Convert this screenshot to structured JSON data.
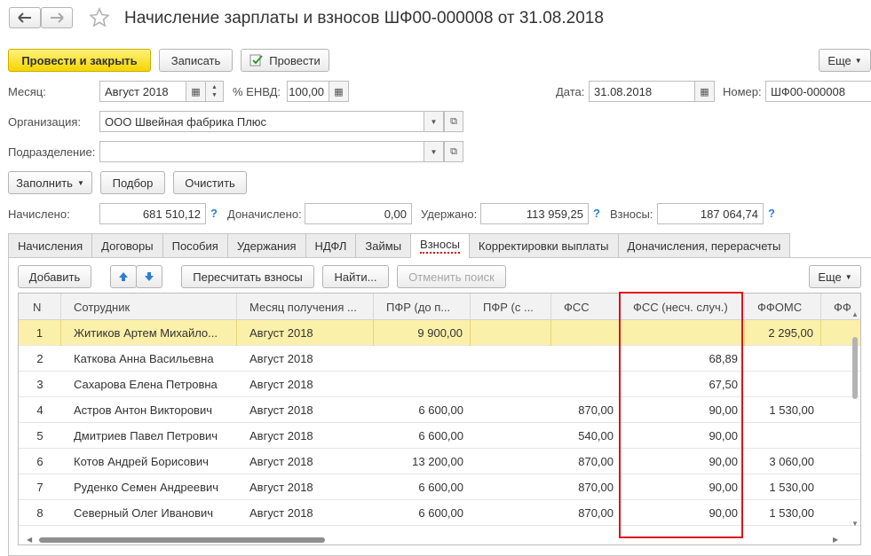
{
  "window": {
    "title": "Начисление зарплаты и взносов ШФ00-000008 от 31.08.2018"
  },
  "toolbar": {
    "post_close": "Провести и закрыть",
    "save": "Записать",
    "post": "Провести",
    "more": "Еще"
  },
  "header": {
    "month_label": "Месяц:",
    "month_value": "Август 2018",
    "envd_label": "% ЕНВД:",
    "envd_value": "100,00",
    "date_label": "Дата:",
    "date_value": "31.08.2018",
    "number_label": "Номер:",
    "number_value": "ШФ00-000008",
    "org_label": "Организация:",
    "org_value": "ООО Швейная фабрика Плюс",
    "dept_label": "Подразделение:",
    "dept_value": ""
  },
  "actions": {
    "fill": "Заполнить",
    "pick": "Подбор",
    "clear": "Очистить"
  },
  "totals": {
    "accrued_label": "Начислено:",
    "accrued_value": "681 510,12",
    "extra_label": "Доначислено:",
    "extra_value": "0,00",
    "withheld_label": "Удержано:",
    "withheld_value": "113 959,25",
    "contrib_label": "Взносы:",
    "contrib_value": "187 064,74",
    "help": "?"
  },
  "tabs": [
    "Начисления",
    "Договоры",
    "Пособия",
    "Удержания",
    "НДФЛ",
    "Займы",
    "Взносы",
    "Корректировки выплаты",
    "Доначисления, перерасчеты"
  ],
  "active_tab": "Взносы",
  "grid_toolbar": {
    "add": "Добавить",
    "recalc": "Пересчитать взносы",
    "find": "Найти...",
    "cancel_search": "Отменить поиск",
    "more": "Еще"
  },
  "table": {
    "columns": [
      "N",
      "Сотрудник",
      "Месяц получения ...",
      "ПФР (до п...",
      "ПФР (с ...",
      "ФСС",
      "ФСС (несч. случ.)",
      "ФФОМС",
      "ФФ"
    ],
    "rows": [
      {
        "n": "1",
        "employee": "Житиков Артем Михайло...",
        "month": "Август 2018",
        "pfr1": "9 900,00",
        "pfr2": "",
        "fss": "",
        "fss_ns": "",
        "ffoms": "2 295,00"
      },
      {
        "n": "2",
        "employee": "Каткова Анна Васильевна",
        "month": "Август 2018",
        "pfr1": "",
        "pfr2": "",
        "fss": "",
        "fss_ns": "68,89",
        "ffoms": ""
      },
      {
        "n": "3",
        "employee": "Сахарова Елена Петровна",
        "month": "Август 2018",
        "pfr1": "",
        "pfr2": "",
        "fss": "",
        "fss_ns": "67,50",
        "ffoms": ""
      },
      {
        "n": "4",
        "employee": "Астров Антон Викторович",
        "month": "Август 2018",
        "pfr1": "6 600,00",
        "pfr2": "",
        "fss": "870,00",
        "fss_ns": "90,00",
        "ffoms": "1 530,00"
      },
      {
        "n": "5",
        "employee": "Дмитриев Павел Петрович",
        "month": "Август 2018",
        "pfr1": "6 600,00",
        "pfr2": "",
        "fss": "540,00",
        "fss_ns": "90,00",
        "ffoms": ""
      },
      {
        "n": "6",
        "employee": "Котов Андрей Борисович",
        "month": "Август 2018",
        "pfr1": "13 200,00",
        "pfr2": "",
        "fss": "870,00",
        "fss_ns": "90,00",
        "ffoms": "3 060,00"
      },
      {
        "n": "7",
        "employee": "Руденко Семен Андреевич",
        "month": "Август 2018",
        "pfr1": "6 600,00",
        "pfr2": "",
        "fss": "870,00",
        "fss_ns": "90,00",
        "ffoms": "1 530,00"
      },
      {
        "n": "8",
        "employee": "Северный Олег Иванович",
        "month": "Август 2018",
        "pfr1": "6 600,00",
        "pfr2": "",
        "fss": "870,00",
        "fss_ns": "90,00",
        "ffoms": "1 530,00"
      }
    ],
    "selected_row": 0
  },
  "colors": {
    "primary_button": "#f5d500",
    "selected_row": "#fbf0a9",
    "highlight_box": "#e0101a",
    "help_icon": "#2a7fd4"
  }
}
